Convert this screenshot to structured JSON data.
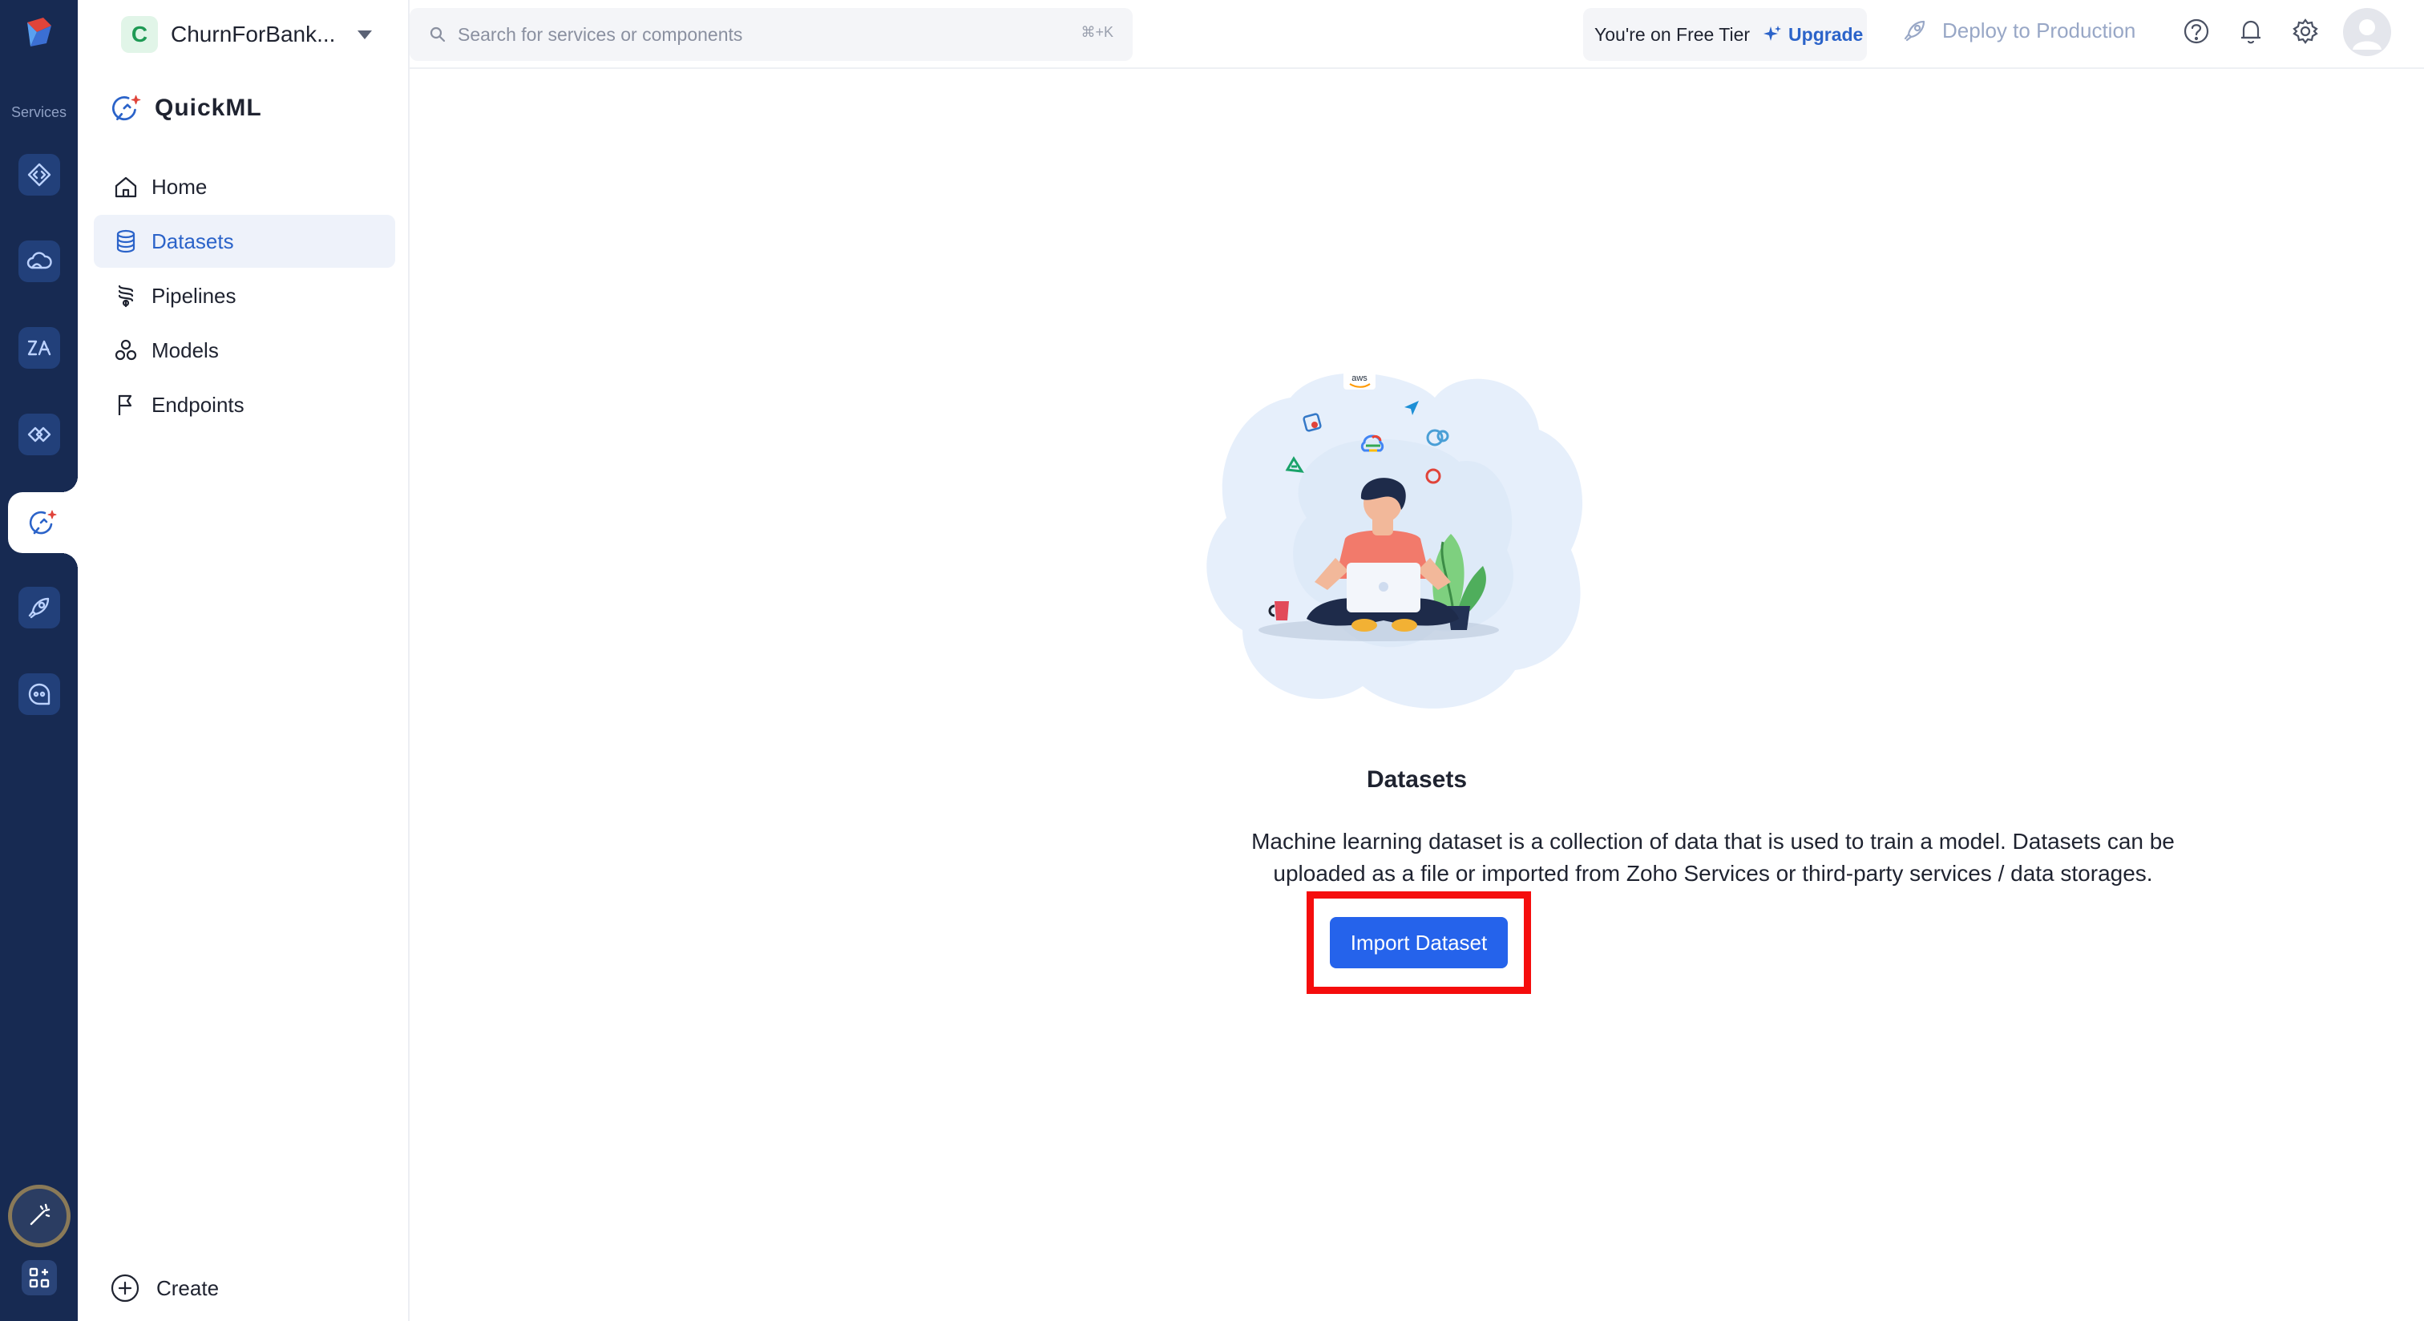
{
  "rail": {
    "label": "Services",
    "items": [
      {
        "icon": "code-icon"
      },
      {
        "icon": "cloud-icon"
      },
      {
        "icon": "zia-icon"
      },
      {
        "icon": "integration-icon"
      },
      {
        "icon": "quickml-icon",
        "active": true
      },
      {
        "icon": "rocket-icon"
      },
      {
        "icon": "chatbot-icon"
      }
    ],
    "bottom": [
      {
        "icon": "magic-wand-icon"
      },
      {
        "icon": "apps-grid-icon"
      }
    ]
  },
  "project": {
    "initial": "C",
    "name": "ChurnForBank..."
  },
  "service": {
    "title": "QuickML"
  },
  "nav": {
    "items": [
      {
        "label": "Home",
        "icon": "home-icon"
      },
      {
        "label": "Datasets",
        "icon": "database-icon",
        "active": true
      },
      {
        "label": "Pipelines",
        "icon": "pipeline-icon"
      },
      {
        "label": "Models",
        "icon": "models-icon"
      },
      {
        "label": "Endpoints",
        "icon": "flag-icon"
      }
    ],
    "create_label": "Create"
  },
  "topbar": {
    "search_placeholder": "Search for services or components",
    "search_shortcut": "⌘+K",
    "tier_text": "You're on Free Tier",
    "upgrade_label": "Upgrade",
    "deploy_label": "Deploy to Production"
  },
  "main": {
    "title": "Datasets",
    "description": "Machine learning dataset is a collection of data that is used to train a model. Datasets can be uploaded as a file or imported from Zoho Services or third-party services / data storages.",
    "import_label": "Import Dataset",
    "illustration_badge": "aws"
  },
  "colors": {
    "rail_bg": "#172a52",
    "accent": "#2563eb",
    "highlight": "#f50d0d",
    "active_nav_bg": "#eef2fa"
  }
}
